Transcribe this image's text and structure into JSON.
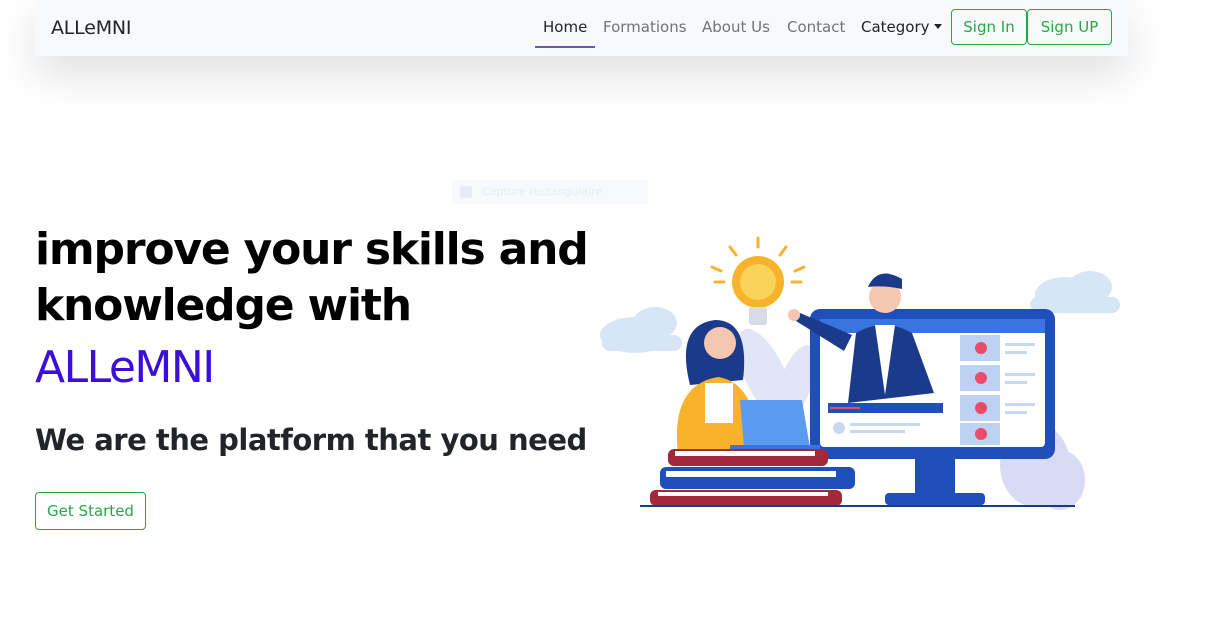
{
  "navbar": {
    "brand": "ALLeMNI",
    "links": [
      {
        "label": "Home",
        "active": true
      },
      {
        "label": "Formations"
      },
      {
        "label": "About Us"
      },
      {
        "label": "Contact"
      }
    ],
    "category_label": "Category",
    "signin_label": "Sign In",
    "signup_label": "Sign UP"
  },
  "overlay": {
    "faint_text": "Capture rectangulaire"
  },
  "hero": {
    "title_line1": "improve your skills and",
    "title_line2": "knowledge with",
    "brand": "ALLeMNI",
    "subtitle": "We are the platform that you need",
    "cta_label": "Get Started"
  },
  "illustration": {
    "icon": "e-learning-illustration"
  },
  "colors": {
    "accent_green": "#28a745",
    "brand_purple": "#3b0fd8",
    "navbar_bg": "#f8f9fa"
  }
}
